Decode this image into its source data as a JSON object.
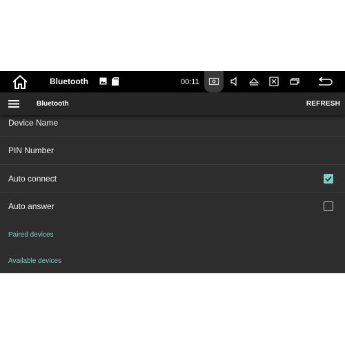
{
  "statusbar": {
    "title": "Bluetooth",
    "time": "00:11",
    "icons": [
      "home-icon",
      "image-icon",
      "sd-card-icon",
      "screenshot-icon",
      "volume-icon",
      "eject-icon",
      "close-window-icon",
      "window-icon",
      "back-icon"
    ]
  },
  "appbar": {
    "title": "Bluetooth",
    "action": "REFRESH",
    "menu_icon": "menu-icon"
  },
  "settings": {
    "device_name": "Device Name",
    "pin_number": "PIN Number",
    "auto_connect": {
      "label": "Auto connect",
      "checked": true
    },
    "auto_answer": {
      "label": "Auto answer",
      "checked": false
    }
  },
  "sections": {
    "paired": "Paired devices",
    "available": "Available devices"
  },
  "colors": {
    "accent": "#80cbc4",
    "background": "#2d2d2d",
    "statusbar": "#000000"
  }
}
